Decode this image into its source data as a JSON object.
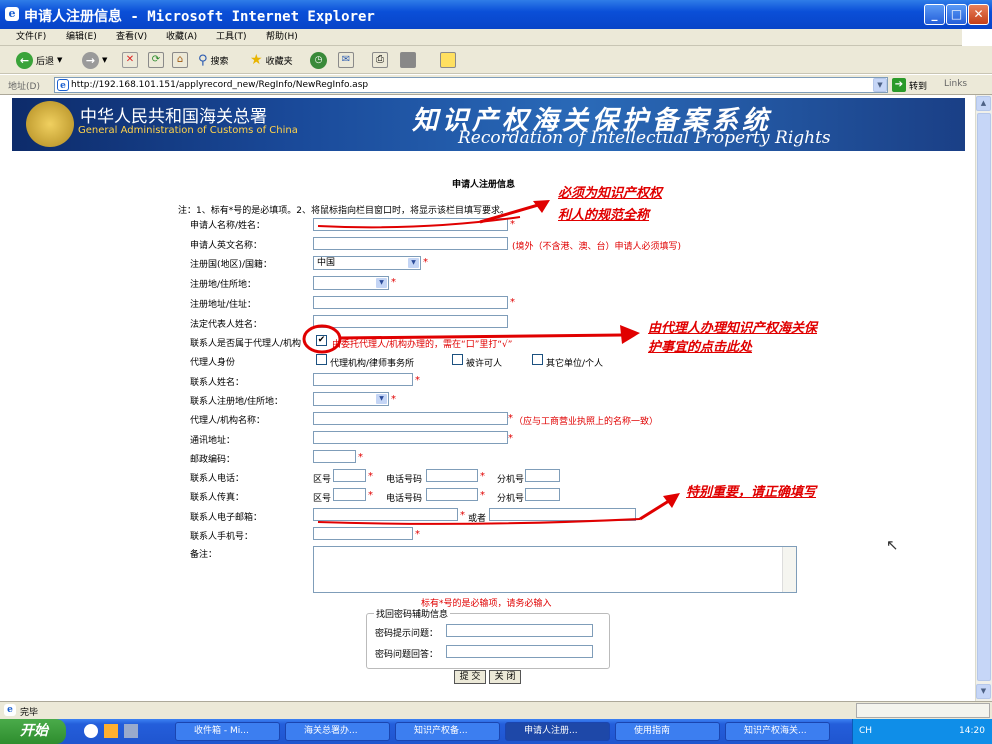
{
  "window": {
    "title": "申请人注册信息 - Microsoft Internet Explorer"
  },
  "menu": [
    "文件(F)",
    "编辑(E)",
    "查看(V)",
    "收藏(A)",
    "工具(T)",
    "帮助(H)"
  ],
  "toolbar": {
    "back": "后退",
    "search": "搜索",
    "favorites": "收藏夹"
  },
  "address": {
    "label": "地址(D)",
    "url": "http://192.168.101.151/applyrecord_new/RegInfo/NewRegInfo.asp",
    "go": "转到",
    "links": "Links"
  },
  "banner": {
    "org_cn": "中华人民共和国海关总署",
    "org_en": "General Administration of Customs of China",
    "system_cn": "知识产权海关保护备案系统",
    "system_en": "Recordation of Intellectual Property Rights"
  },
  "form": {
    "heading": "申请人注册信息",
    "note": "注：1、标有*号的是必填项。2、将鼠标指向栏目窗口时，将显示该栏目填写要求。",
    "star": "*",
    "name": "申请人名称/姓名：",
    "name_en": "申请人英文名称：",
    "name_en_hint": "(境外（不含港、澳、台）申请人必须填写)",
    "country": "注册国(地区)/国籍：",
    "country_value": "中国",
    "residence": "注册地/住所地：",
    "address": "注册地址/住址：",
    "legal_rep": "法定代表人姓名：",
    "is_agent": "联系人是否属于代理人/机构",
    "is_agent_hint": "由委托代理人/机构办理的，需在“口”里打“√”",
    "agent_type": "代理人身份",
    "agent_opt1": "代理机构/律师事务所",
    "agent_opt2": "被许可人",
    "agent_opt3": "其它单位/个人",
    "contact_name": "联系人姓名：",
    "contact_residence": "联系人注册地/住所地：",
    "agency_name": "代理人/机构名称：",
    "agency_hint": "（应与工商营业执照上的名称一致）",
    "mail_addr": "通讯地址：",
    "postcode": "邮政编码：",
    "phone": "联系人电话：",
    "fax": "联系人传真：",
    "area_code": "区号",
    "phone_no": "电话号码",
    "ext": "分机号",
    "email": "联系人电子邮箱：",
    "or": "或者",
    "mobile": "联系人手机号：",
    "remark": "备注：",
    "required_note": "标有*号的是必输项，请务必输入",
    "pwd_legend": "找回密码辅助信息",
    "pwd_question": "密码提示问题：",
    "pwd_answer": "密码问题回答：",
    "submit": "提 交",
    "close": "关 闭"
  },
  "annotations": {
    "a1_line1": "必须为知识产权权",
    "a1_line2": "利人的规范全称",
    "a2_line1": "由代理人办理知识产权海关保",
    "a2_line2": "护事宜的点击此处",
    "a3": "特别重要，请正确填写"
  },
  "status": {
    "text": "完毕"
  },
  "taskbar": {
    "start": "开始",
    "tasks": [
      "收件箱 - Mi...",
      "海关总署办...",
      "知识产权备...",
      "申请人注册...",
      "使用指南",
      "知识产权海关..."
    ],
    "lang": "CH",
    "time": "14:20"
  }
}
